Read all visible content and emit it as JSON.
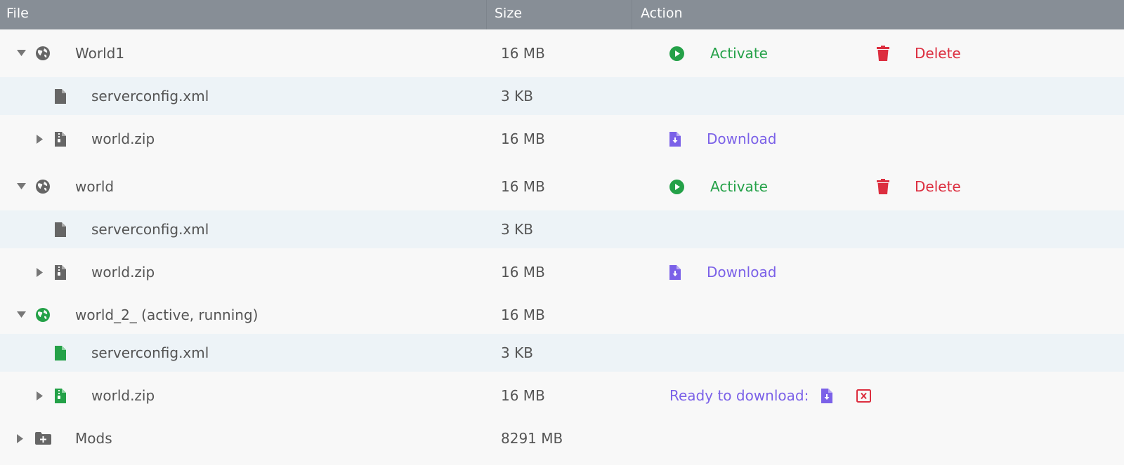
{
  "header": {
    "file": "File",
    "size": "Size",
    "action": "Action"
  },
  "colors": {
    "green": "#24a148",
    "red": "#dc2e3f",
    "purple": "#7b61e8",
    "gray": "#666666"
  },
  "rows": [
    {
      "name": "World1",
      "size": "16 MB",
      "icon": "globe-icon",
      "caret": "expanded",
      "actions": {
        "activate": "Activate",
        "delete": "Delete"
      }
    },
    {
      "name": "serverconfig.xml",
      "size": "3 KB",
      "icon": "file-icon"
    },
    {
      "name": "world.zip",
      "size": "16 MB",
      "icon": "zip-file-icon",
      "caret": "collapsed",
      "actions": {
        "download": "Download"
      }
    },
    {
      "name": "world",
      "size": "16 MB",
      "icon": "globe-icon",
      "caret": "expanded",
      "actions": {
        "activate": "Activate",
        "delete": "Delete"
      }
    },
    {
      "name": "serverconfig.xml",
      "size": "3 KB",
      "icon": "file-icon"
    },
    {
      "name": "world.zip",
      "size": "16 MB",
      "icon": "zip-file-icon",
      "caret": "collapsed",
      "actions": {
        "download": "Download"
      }
    },
    {
      "name": "world_2_ (active, running)",
      "size": "16 MB",
      "icon": "globe-icon-active",
      "caret": "expanded"
    },
    {
      "name": "serverconfig.xml",
      "size": "3 KB",
      "icon": "file-icon-active"
    },
    {
      "name": "world.zip",
      "size": "16 MB",
      "icon": "zip-file-icon-active",
      "caret": "collapsed",
      "actions": {
        "ready": "Ready to download:"
      }
    },
    {
      "name": "Mods",
      "size": "8291 MB",
      "icon": "folder-plus-icon",
      "caret": "collapsed"
    }
  ]
}
